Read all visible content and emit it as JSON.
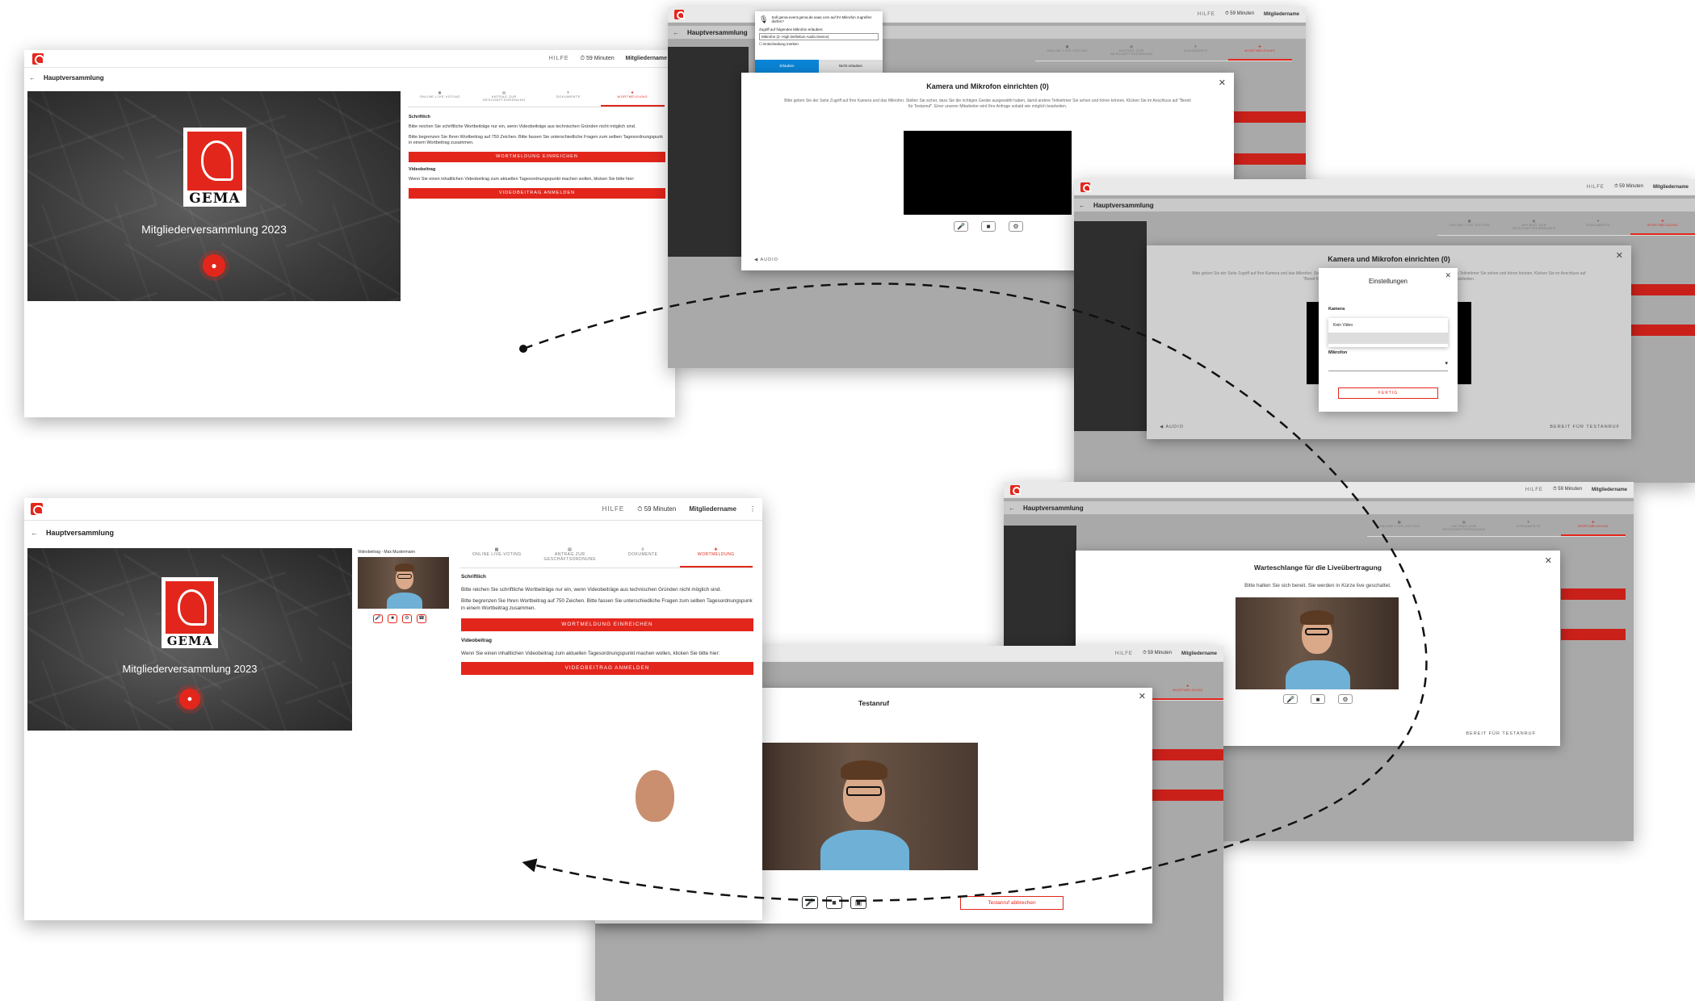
{
  "app": {
    "logo_text": "GEMA",
    "help": "HILFE",
    "timer": "59 Minuten",
    "user": "Mitgliedername",
    "page_title": "Hauptversammlung",
    "event_title": "Mitgliederversammlung 2023",
    "brand_word": "GEMA"
  },
  "tabs": [
    {
      "icon": "ballot-icon",
      "label": "ONLINE LIVE-VOTING"
    },
    {
      "icon": "motion-icon",
      "label": "ANTRAG ZUR GESCHÄFTSORDNUNG"
    },
    {
      "icon": "documents-icon",
      "label": "DOKUMENTE"
    },
    {
      "icon": "speaker-request-icon",
      "label": "WORTMELDUNG"
    }
  ],
  "wortmeldung": {
    "written_heading": "Schriftlich",
    "written_text": "Bitte reichen Sie schriftliche Wortbeiträge nur ein, wenn Videobeiträge aus technischen Gründen nicht möglich sind.",
    "limit_text": "Bitte begrenzen Sie Ihren Wortbeitrag auf 750 Zeichen. Bitte fassen Sie unterschiedliche Fragen zum selben Tagesordnungspunk in einem Wortbeitrag zusammen.",
    "submit_button": "WORTMELDUNG EINREICHEN",
    "video_heading": "Videobeitrag",
    "video_text": "Wenn Sie einen inhaltlichen Videobeitrag zum aktuellen Tagesordnungspunkt machen wollen, klicken Sie bitte hier:",
    "video_button": "VIDEOBEITRAG ANMELDEN"
  },
  "self_view_caption": "Videobeitrag - Max Mustermann",
  "permission_popup": {
    "site": "gema-event.gema.de.saas.com",
    "line1": "Soll gema-event.gema.de.saas.com auf Ihr Mikrofon zugreifen dürfen?",
    "line2": "Zugriff auf folgendes Mikrofon erlauben:",
    "device": "Mikrofon (2- High Definition Audio Device)",
    "remember": "Entscheidung merken",
    "allow": "Erlauben",
    "deny": "Nicht erlauben"
  },
  "camera_modal": {
    "title": "Kamera und Mikrofon einrichten (0)",
    "text": "Bitte geben Sie der Seite Zugriff auf Ihre Kamera und das Mikrofon. Stellen Sie sicher, dass Sie die richtigen Geräte ausgewählt haben, damit andere Teilnehmer Sie sehen und hören können. Klicken Sie im Anschluss auf \"Bereit für Testanruf\". Einer unserer Mitarbeiter wird Ihre Anfrage sobald wie möglich bearbeiten.",
    "audio": "AUDIO",
    "ready": "BEREIT FÜR TESTANRUF"
  },
  "settings_modal": {
    "title": "Einstellungen",
    "camera_label": "Kamera",
    "camera_option": "Kein Video",
    "mic_label": "Mikrofon",
    "done": "FERTIG"
  },
  "queue_modal": {
    "title": "Warteschlange für die Liveübertragung",
    "text": "Bitte halten Sie sich bereit. Sie werden in Kürze live geschaltet.",
    "ready": "BEREIT FÜR TESTANRUF"
  },
  "test_call": {
    "title": "Testanruf",
    "cancel": "Testanruf abbrechen"
  },
  "colors": {
    "accent": "#e3261c",
    "overlay": "#a9a9a9",
    "dark": "#3a3a3a"
  }
}
